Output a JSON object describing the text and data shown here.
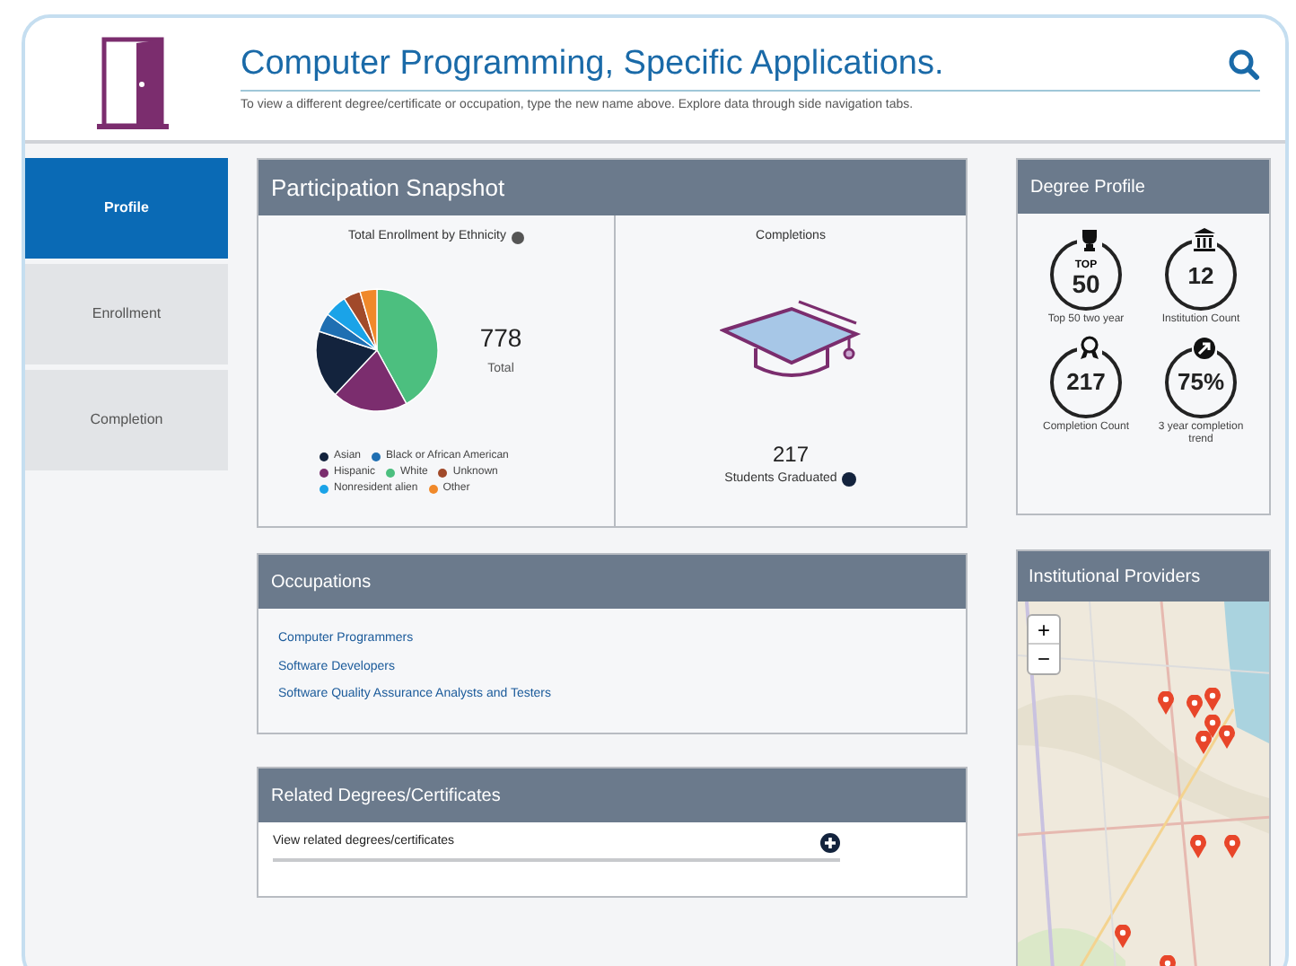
{
  "header": {
    "title": "Computer Programming, Specific Applications.",
    "subtitle": "To view a different degree/certificate or occupation, type the new name above. Explore data through side navigation tabs."
  },
  "nav": [
    {
      "label": "Profile",
      "selected": true
    },
    {
      "label": "Enrollment",
      "selected": false
    },
    {
      "label": "Completion",
      "selected": false
    }
  ],
  "snapshot": {
    "title": "Participation Snapshot",
    "enrollment": {
      "title": "Total Enrollment by Ethnicity",
      "total": "778",
      "total_label": "Total",
      "legend": [
        {
          "label": "Asian",
          "color": "#13233d"
        },
        {
          "label": "Black or African American",
          "color": "#1f6fb2"
        },
        {
          "label": "Hispanic",
          "color": "#7b2d6e"
        },
        {
          "label": "White",
          "color": "#4cbf7f"
        },
        {
          "label": "Unknown",
          "color": "#a14a2a"
        },
        {
          "label": "Nonresident alien",
          "color": "#1aa3e8"
        },
        {
          "label": "Other",
          "color": "#f0892a"
        }
      ]
    },
    "completions": {
      "title": "Completions",
      "count": "217",
      "label": "Students Graduated"
    }
  },
  "occupations": {
    "title": "Occupations",
    "items": [
      "Computer Programmers",
      "Software Developers",
      "Software Quality Assurance Analysts and Testers"
    ]
  },
  "related": {
    "title": "Related Degrees/Certificates",
    "link": "View related degrees/certificates"
  },
  "degree_profile": {
    "title": "Degree Profile",
    "stats": [
      {
        "kind": "trophy",
        "prefix": "TOP",
        "value": "50",
        "label": "Top 50 two year"
      },
      {
        "kind": "building",
        "value": "12",
        "label": "Institution Count"
      },
      {
        "kind": "ribbon",
        "value": "217",
        "label": "Completion Count"
      },
      {
        "kind": "trend",
        "value": "75%",
        "label": "3 year completion trend"
      }
    ]
  },
  "providers": {
    "title": "Institutional Providers",
    "zoom_in": "+",
    "zoom_out": "−"
  }
}
